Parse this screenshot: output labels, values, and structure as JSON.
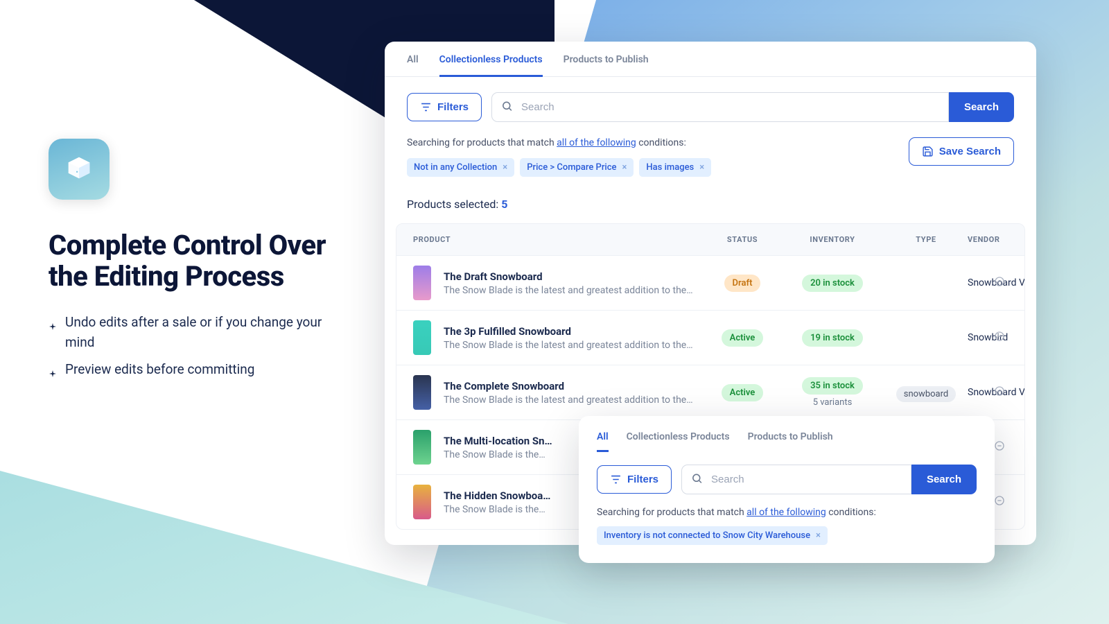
{
  "marketing": {
    "headline": "Complete Control Over the Editing Process",
    "bullets": [
      "Undo edits after a sale or if you change your mind",
      "Preview edits before committing"
    ]
  },
  "main_card": {
    "tabs": [
      "All",
      "Collectionless Products",
      "Products to Publish"
    ],
    "active_tab_index": 1,
    "filters_label": "Filters",
    "search_placeholder": "Search",
    "search_button": "Search",
    "condition_prefix": "Searching for products that match ",
    "condition_link": "all of the following",
    "condition_suffix": " conditions:",
    "chips": [
      "Not in any Collection",
      "Price > Compare Price",
      "Has images"
    ],
    "save_search_label": "Save Search",
    "selected_prefix": "Products selected: ",
    "selected_count": "5",
    "columns": [
      "PRODUCT",
      "STATUS",
      "INVENTORY",
      "TYPE",
      "VENDOR"
    ],
    "rows": [
      {
        "name": "The Draft Snowboard",
        "desc": "The Snow Blade is the latest and greatest addition to the w…",
        "status": "Draft",
        "status_kind": "draft",
        "stock": "20 in stock",
        "variants": "",
        "type": "",
        "vendor": "Snowboard Ven…",
        "thumb": "linear-gradient(180deg,#9d7de8,#e89acb)"
      },
      {
        "name": "The 3p Fulfilled Snowboard",
        "desc": "The Snow Blade is the latest and greatest addition to the w…",
        "status": "Active",
        "status_kind": "active",
        "stock": "19 in stock",
        "variants": "",
        "type": "",
        "vendor": "Snowbird",
        "thumb": "linear-gradient(180deg,#3ad1bf,#37c9b6)"
      },
      {
        "name": "The Complete Snowboard",
        "desc": "The Snow Blade is the latest and greatest addition to the w…",
        "status": "Active",
        "status_kind": "active",
        "stock": "35 in stock",
        "variants": "5 variants",
        "type": "snowboard",
        "vendor": "Snowboard Ven…",
        "thumb": "linear-gradient(180deg,#2a3550,#4560a6)"
      },
      {
        "name": "The Multi-location Sn…",
        "desc": "The Snow Blade is the…",
        "status": "",
        "status_kind": "",
        "stock": "",
        "variants": "",
        "type": "",
        "vendor": "",
        "thumb": "linear-gradient(180deg,#2aa06b,#6ed38f)"
      },
      {
        "name": "The Hidden Snowboa…",
        "desc": "The Snow Blade is the…",
        "status": "",
        "status_kind": "",
        "stock": "",
        "variants": "",
        "type": "",
        "vendor": "",
        "thumb": "linear-gradient(180deg,#e8b23e,#d85a8a)"
      }
    ]
  },
  "overlay_card": {
    "tabs": [
      "All",
      "Collectionless Products",
      "Products to Publish"
    ],
    "active_tab_index": 0,
    "filters_label": "Filters",
    "search_placeholder": "Search",
    "search_button": "Search",
    "condition_prefix": "Searching for products that match ",
    "condition_link": "all of the following",
    "condition_suffix": " conditions:",
    "chips": [
      "Inventory is not connected to Snow City Warehouse"
    ]
  }
}
